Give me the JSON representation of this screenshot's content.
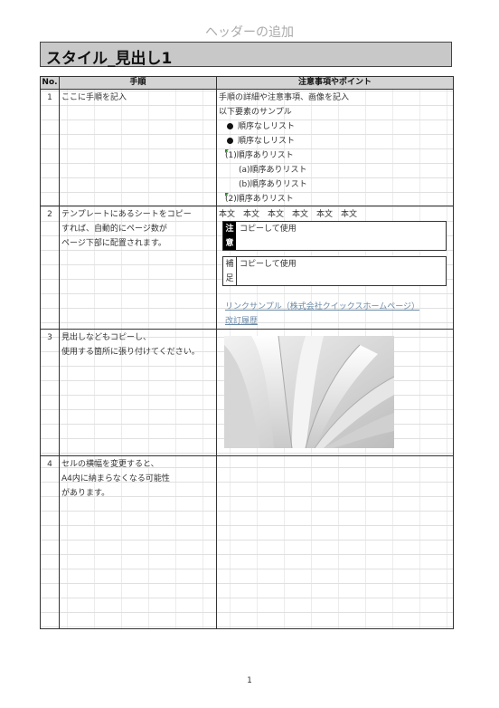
{
  "page": {
    "header_text": "ヘッダーの追加",
    "title": "スタイル_見出し1",
    "footer_page": "1"
  },
  "table": {
    "headers": {
      "no": "No.",
      "steps": "手順",
      "notes": "注意事項やポイント"
    },
    "rows": [
      {
        "no": "1",
        "steps": [
          "ここに手順を記入"
        ],
        "notes": {
          "lines": [
            "手順の詳細や注意事項、画像を記入",
            "以下要素のサンプル"
          ],
          "unordered": [
            "順序なしリスト",
            "順序なしリスト"
          ],
          "ordered": [
            {
              "marker": "(1)",
              "text": "順序ありリスト"
            },
            {
              "marker": "(a)",
              "text": "順序ありリスト"
            },
            {
              "marker": "(b)",
              "text": "順序ありリスト"
            },
            {
              "marker": "(2)",
              "text": "順序ありリスト"
            }
          ]
        }
      },
      {
        "no": "2",
        "steps": [
          "テンプレートにあるシートをコピー",
          "すれば、自動的にページ数が",
          "ページ下部に配置されます。"
        ],
        "notes": {
          "body_text": "本文　本文　本文　本文　本文　本文",
          "caution_label": "注意",
          "caution_text": "コピーして使用",
          "supplement_label": "補足",
          "supplement_text": "コピーして使用",
          "link_text": "リンクサンプル（株式会社クイックスホームページ）",
          "history_link": "改訂履歴"
        }
      },
      {
        "no": "3",
        "steps": [
          "見出しなどもコピーし、",
          "使用する箇所に張り付けてください。"
        ],
        "notes": {
          "image": "open-book-pages-photo"
        }
      },
      {
        "no": "4",
        "steps": [
          "セルの横幅を変更すると、",
          "A4内に納まらなくなる可能性",
          "があります。"
        ],
        "notes": {}
      }
    ]
  }
}
